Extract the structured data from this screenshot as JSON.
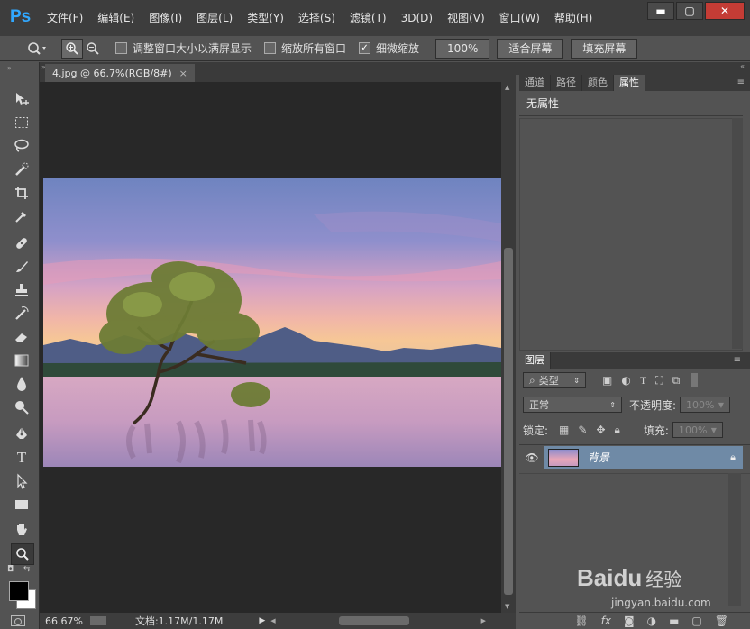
{
  "app": {
    "logo": "Ps"
  },
  "menu": [
    "文件(F)",
    "编辑(E)",
    "图像(I)",
    "图层(L)",
    "类型(Y)",
    "选择(S)",
    "滤镜(T)",
    "3D(D)",
    "视图(V)",
    "窗口(W)",
    "帮助(H)"
  ],
  "window_controls": {
    "minimize": "▬",
    "maximize": "▢",
    "close": "✕"
  },
  "options": {
    "resize_windows": {
      "label": "调整窗口大小以满屏显示",
      "checked": false
    },
    "zoom_all": {
      "label": "缩放所有窗口",
      "checked": false
    },
    "scrubby_zoom": {
      "label": "细微缩放",
      "checked": true,
      "mark": "✓"
    },
    "zoom_100_label": "100%",
    "fit_screen_label": "适合屏幕",
    "fill_screen_label": "填充屏幕"
  },
  "document": {
    "tab_title": "4.jpg @ 66.7%(RGB/8#)",
    "close": "×"
  },
  "status": {
    "zoom": "66.67%",
    "doc_info": "文档:1.17M/1.17M",
    "arrow": "▶"
  },
  "properties_panel": {
    "tabs": [
      "通道",
      "路径",
      "颜色",
      "属性"
    ],
    "active_tab": 3,
    "content": "无属性"
  },
  "layers_panel": {
    "title": "图层",
    "filter_kind": "类型",
    "blend_mode": "正常",
    "opacity_label": "不透明度:",
    "opacity_value": "100%",
    "lock_label": "锁定:",
    "fill_label": "填充:",
    "fill_value": "100%",
    "layers": [
      {
        "name": "背景",
        "visible": true,
        "locked": true
      }
    ]
  },
  "watermark": {
    "brand": "Baidu",
    "suffix": "经验",
    "url": "jingyan.baidu.com"
  },
  "colors": {
    "accent": "#31a8ff",
    "panel": "#535353",
    "dark": "#282828"
  }
}
